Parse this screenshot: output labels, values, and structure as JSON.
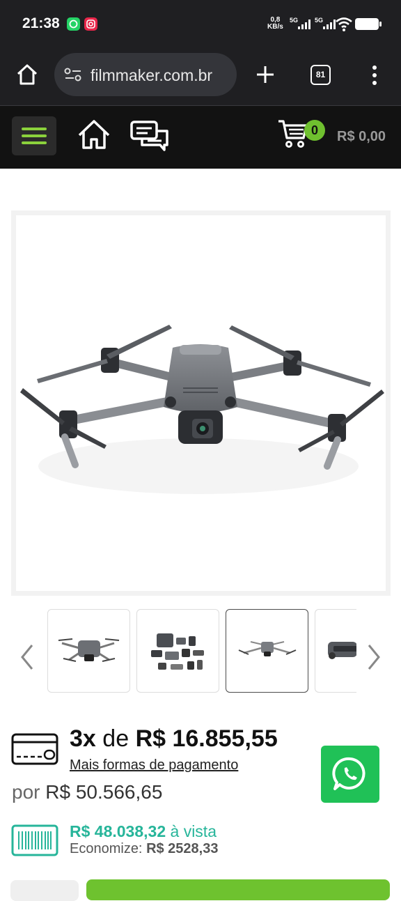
{
  "status_bar": {
    "time": "21:38",
    "net_speed_value": "0,8",
    "net_speed_unit": "KB/s",
    "network_1": "5G",
    "network_2": "5G"
  },
  "browser": {
    "url": "filmmaker.com.br",
    "tab_count": "81"
  },
  "site_header": {
    "cart_count": "0",
    "cart_total": "R$ 0,00",
    "accent_color": "#8bd23c"
  },
  "product": {
    "image_icon": "drone-image",
    "thumbnails": [
      {
        "icon": "drone-thumbnail-front"
      },
      {
        "icon": "drone-kit-thumbnail"
      },
      {
        "icon": "drone-thumbnail-top"
      },
      {
        "icon": "drone-thumbnail-partial"
      }
    ]
  },
  "pricing": {
    "installment_count": "3x",
    "installment_de": "de",
    "installment_value": "R$ 16.855,55",
    "more_payment_options": "Mais formas de pagamento",
    "por_label": "por",
    "full_price": "R$ 50.566,65",
    "cash_price": "R$ 48.038,32",
    "cash_label": "à vista",
    "savings_label": "Economize:",
    "savings_value": "R$ 2528,33",
    "cash_color": "#27b59a"
  }
}
